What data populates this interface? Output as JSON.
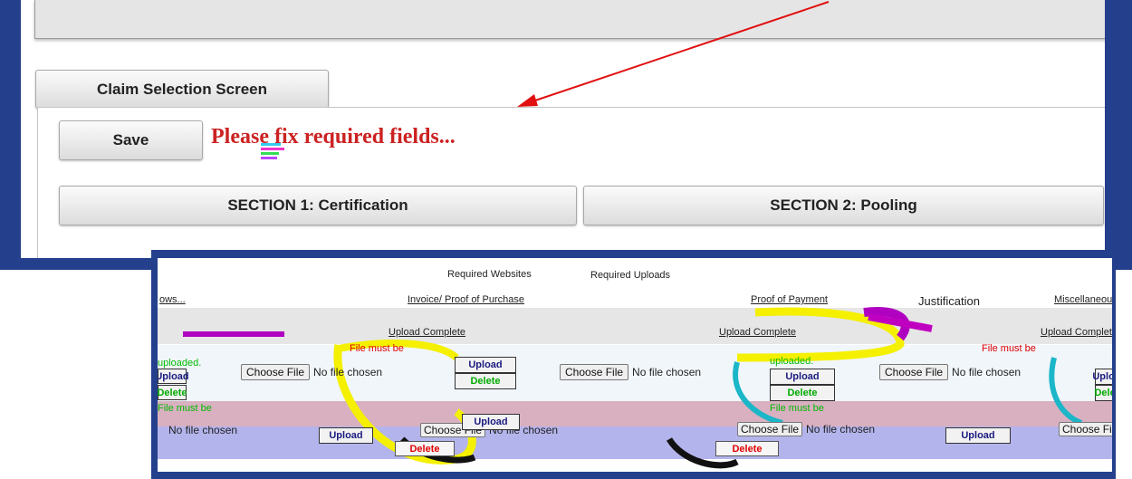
{
  "top_panel": {
    "claim_selection_label": "Claim Selection Screen",
    "save_label": "Save",
    "error_message": "Please fix required fields...",
    "section1_label": "SECTION 1: Certification",
    "section2_label": "SECTION 2: Pooling"
  },
  "uploads_panel": {
    "required_websites_label": "Required Websites",
    "required_uploads_label": "Required Uploads",
    "col_headers": {
      "ows": "ows...",
      "invoice": "Invoice/ Proof of Purchase",
      "payment": "Proof of Payment",
      "justification": "Justification",
      "misc": "Miscellaneous"
    },
    "upload_complete_label": "Upload Complete",
    "file_must_be_label": "File must be",
    "uploaded_label": "uploaded.",
    "choose_file_label": "Choose File",
    "no_file_label": "No file chosen",
    "upload_label": "Upload",
    "delete_label": "Delete"
  },
  "colors": {
    "frame": "#24408c",
    "error_red": "#cc2222",
    "delete_green": "#00bb00",
    "highlight_yellow": "#f4f000",
    "row_pink": "#d9b0c0",
    "row_lavender": "#b4b4ec"
  }
}
